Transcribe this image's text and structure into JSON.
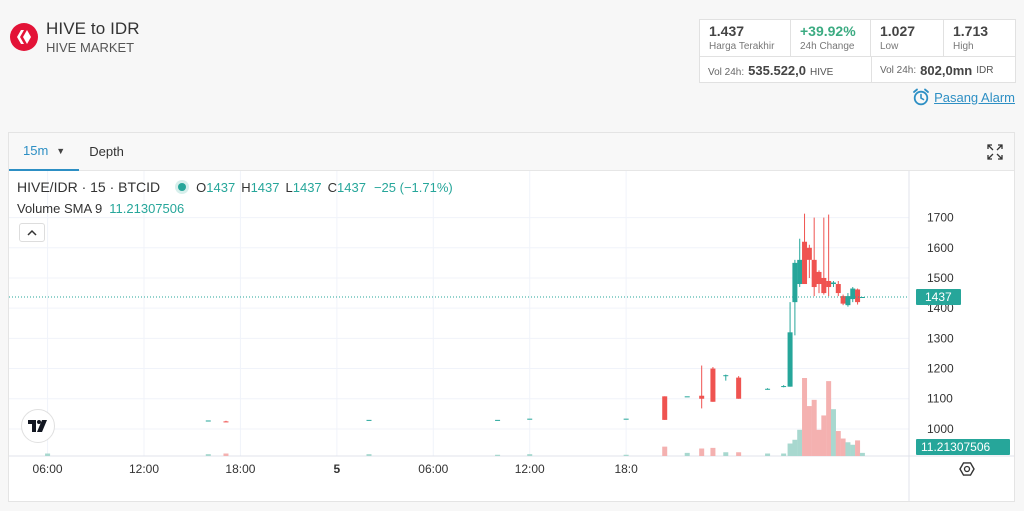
{
  "header": {
    "title": "HIVE to IDR",
    "subtitle": "HIVE MARKET",
    "brand_color": "#e31337"
  },
  "stats": {
    "last_price": {
      "value": "1.437",
      "label": "Harga Terakhir"
    },
    "change_24h": {
      "value": "+39.92%",
      "label": "24h Change"
    },
    "low": {
      "value": "1.027",
      "label": "Low"
    },
    "high": {
      "value": "1.713",
      "label": "High"
    },
    "vol_base": {
      "label": "Vol 24h:",
      "value": "535.522,0",
      "unit": "HIVE"
    },
    "vol_quote": {
      "label": "Vol 24h:",
      "value": "802,0mn",
      "unit": "IDR"
    }
  },
  "alarm": {
    "label": "Pasang Alarm",
    "icon": "alarm-clock-icon"
  },
  "toolbar": {
    "timeframe": "15m",
    "depth_tab": "Depth",
    "fullscreen_icon": "fullscreen-icon"
  },
  "legend": {
    "symbol": "HIVE/IDR · 15 · BTCID",
    "o_label": "O",
    "o": "1437",
    "h_label": "H",
    "h": "1437",
    "l_label": "L",
    "l": "1437",
    "c_label": "C",
    "c": "1437",
    "change": "−25 (−1.71%)",
    "volume_label": "Volume SMA 9",
    "volume_value": "11.21307506"
  },
  "chart_data": {
    "type": "candlestick",
    "symbol": "HIVE/IDR",
    "interval": "15",
    "exchange": "BTCID",
    "x_ticks": [
      "06:00",
      "12:00",
      "18:00",
      "5",
      "06:00",
      "12:00",
      "18:0"
    ],
    "y_ticks": [
      1000,
      1100,
      1200,
      1300,
      1400,
      1500,
      1600,
      1700
    ],
    "ylim": [
      970,
      1745
    ],
    "last_price_label": "1437",
    "volume_label": "11.21307506",
    "colors": {
      "up": "#26a69a",
      "down": "#ef5350",
      "vol_up": "#a8d8cf",
      "vol_down": "#f4b1b0",
      "price_line": "#26a69a"
    },
    "grid": true,
    "candles": [
      {
        "t": 0,
        "o": 1027,
        "h": 1027,
        "l": 1027,
        "c": 1027,
        "v": 0.4
      },
      {
        "t": 10,
        "o": 1028,
        "h": 1028,
        "l": 1028,
        "c": 1028,
        "v": 0.3
      },
      {
        "t": 11.1,
        "o": 1025,
        "h": 1027,
        "l": 1023,
        "c": 1024,
        "v": 0.4
      },
      {
        "t": 20,
        "o": 1030,
        "h": 1030,
        "l": 1030,
        "c": 1030,
        "v": 0.3
      },
      {
        "t": 28,
        "o": 1030,
        "h": 1030,
        "l": 1030,
        "c": 1030,
        "v": 0.2
      },
      {
        "t": 30,
        "o": 1034,
        "h": 1034,
        "l": 1034,
        "c": 1034,
        "v": 0.3
      },
      {
        "t": 36,
        "o": 1034,
        "h": 1034,
        "l": 1034,
        "c": 1034,
        "v": 0.2
      },
      {
        "t": 38.4,
        "o": 1108,
        "h": 1108,
        "l": 1030,
        "c": 1030,
        "v": 1.5
      },
      {
        "t": 39.8,
        "o": 1108,
        "h": 1108,
        "l": 1108,
        "c": 1108,
        "v": 0.5
      },
      {
        "t": 40.7,
        "o": 1110,
        "h": 1210,
        "l": 1068,
        "c": 1100,
        "v": 1.2
      },
      {
        "t": 41.4,
        "o": 1200,
        "h": 1205,
        "l": 1090,
        "c": 1090,
        "v": 1.3
      },
      {
        "t": 42.2,
        "o": 1175,
        "h": 1180,
        "l": 1160,
        "c": 1178,
        "v": 0.6
      },
      {
        "t": 43,
        "o": 1170,
        "h": 1175,
        "l": 1100,
        "c": 1100,
        "v": 0.6
      },
      {
        "t": 44.8,
        "o": 1133,
        "h": 1135,
        "l": 1130,
        "c": 1133,
        "v": 0.4
      },
      {
        "t": 45.8,
        "o": 1140,
        "h": 1145,
        "l": 1138,
        "c": 1142,
        "v": 0.4
      },
      {
        "t": 46.2,
        "o": 1140,
        "h": 1420,
        "l": 1140,
        "c": 1320,
        "v": 2.0
      },
      {
        "t": 46.5,
        "o": 1420,
        "h": 1560,
        "l": 1310,
        "c": 1550,
        "v": 2.6
      },
      {
        "t": 46.8,
        "o": 1480,
        "h": 1630,
        "l": 1470,
        "c": 1560,
        "v": 4.2
      },
      {
        "t": 47.1,
        "o": 1620,
        "h": 1713,
        "l": 1500,
        "c": 1480,
        "v": 12.5
      },
      {
        "t": 47.4,
        "o": 1600,
        "h": 1610,
        "l": 1500,
        "c": 1560,
        "v": 8.0
      },
      {
        "t": 47.7,
        "o": 1560,
        "h": 1700,
        "l": 1440,
        "c": 1470,
        "v": 9.0
      },
      {
        "t": 48.0,
        "o": 1520,
        "h": 1525,
        "l": 1450,
        "c": 1480,
        "v": 4.2
      },
      {
        "t": 48.3,
        "o": 1500,
        "h": 1700,
        "l": 1445,
        "c": 1450,
        "v": 6.5
      },
      {
        "t": 48.6,
        "o": 1490,
        "h": 1710,
        "l": 1440,
        "c": 1470,
        "v": 12.0
      },
      {
        "t": 48.9,
        "o": 1480,
        "h": 1490,
        "l": 1470,
        "c": 1485,
        "v": 7.5
      },
      {
        "t": 49.2,
        "o": 1480,
        "h": 1490,
        "l": 1440,
        "c": 1450,
        "v": 4.0
      },
      {
        "t": 49.5,
        "o": 1440,
        "h": 1445,
        "l": 1410,
        "c": 1415,
        "v": 2.8
      },
      {
        "t": 49.8,
        "o": 1410,
        "h": 1450,
        "l": 1405,
        "c": 1440,
        "v": 2.2
      },
      {
        "t": 50.1,
        "o": 1430,
        "h": 1470,
        "l": 1420,
        "c": 1465,
        "v": 1.8
      },
      {
        "t": 50.4,
        "o": 1462,
        "h": 1465,
        "l": 1412,
        "c": 1420,
        "v": 2.5
      },
      {
        "t": 50.7,
        "o": 1437,
        "h": 1437,
        "l": 1437,
        "c": 1437,
        "v": 0.5
      }
    ]
  }
}
